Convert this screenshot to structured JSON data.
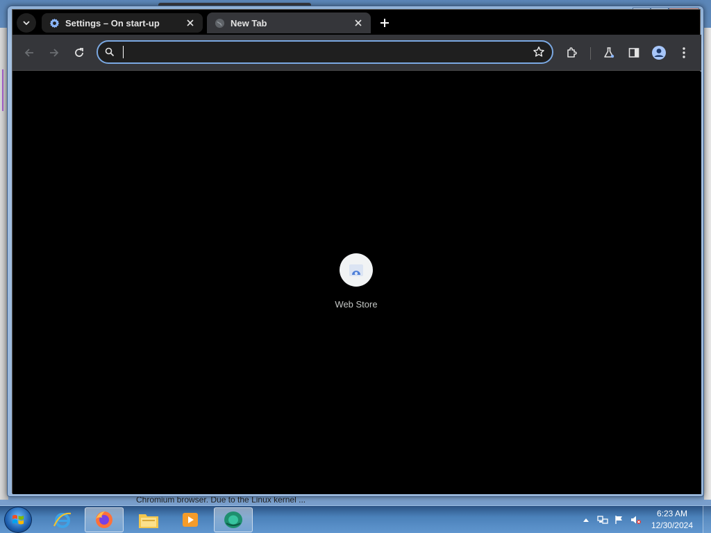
{
  "desktop": {
    "background_text": "Chromium browser. Due to the Linux kernel ..."
  },
  "browser": {
    "tabs": [
      {
        "title": "Settings – On start-up",
        "icon": "gear-icon",
        "active": false
      },
      {
        "title": "New Tab",
        "icon": "globe-icon",
        "active": true
      }
    ],
    "omnibox": {
      "value": "",
      "placeholder": ""
    },
    "toolbar_icons": [
      "back-icon",
      "forward-icon",
      "reload-icon",
      "star-icon",
      "extensions-icon",
      "labs-icon",
      "side-panel-icon",
      "profile-icon",
      "menu-icon"
    ]
  },
  "new_tab": {
    "shortcuts": [
      {
        "label": "Web Store",
        "icon": "web-store-icon"
      }
    ]
  },
  "taskbar": {
    "apps": [
      "internet-explorer-icon",
      "firefox-icon",
      "file-explorer-icon",
      "media-player-icon",
      "chromium-icon"
    ],
    "clock": {
      "time": "6:23 AM",
      "date": "12/30/2024"
    }
  },
  "colors": {
    "accent": "#7ba9e3",
    "tab_active": "#35363a",
    "content_bg": "#000000"
  }
}
